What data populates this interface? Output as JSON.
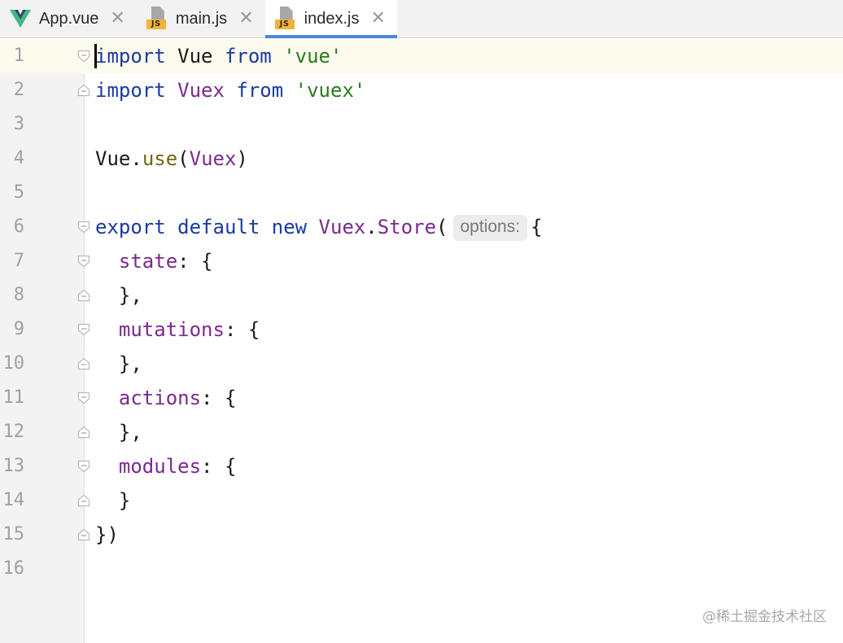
{
  "tabs": [
    {
      "label": "App.vue",
      "icon": "vue-icon",
      "active": false
    },
    {
      "label": "main.js",
      "icon": "js-file-icon",
      "active": false
    },
    {
      "label": "index.js",
      "icon": "js-file-icon",
      "active": true
    }
  ],
  "js_badge": "JS",
  "close_glyph": "✕",
  "hint": "options:",
  "line_numbers": [
    "1",
    "2",
    "3",
    "4",
    "5",
    "6",
    "7",
    "8",
    "9",
    "10",
    "11",
    "12",
    "13",
    "14",
    "15",
    "16"
  ],
  "code": {
    "l1": {
      "kw1": "import",
      "name": " Vue ",
      "kw2": "from",
      "str": " 'vue'"
    },
    "l2": {
      "kw1": "import",
      "name": " Vuex ",
      "kw2": "from",
      "str": " 'vuex'"
    },
    "l4": {
      "obj": "Vue",
      "dot": ".",
      "fn": "use",
      "open": "(",
      "arg": "Vuex",
      "close": ")"
    },
    "l6": {
      "kw1": "export",
      "kw2": " default",
      "kw3": " new",
      "cls": " Vuex",
      "dot": ".",
      "ctor": "Store",
      "open": "(",
      "brace": "{"
    },
    "l7": {
      "prop": "  state",
      "rest": ": {"
    },
    "l8": {
      "text": "  },"
    },
    "l9": {
      "prop": "  mutations",
      "rest": ": {"
    },
    "l10": {
      "text": "  },"
    },
    "l11": {
      "prop": "  actions",
      "rest": ": {"
    },
    "l12": {
      "text": "  },"
    },
    "l13": {
      "prop": "  modules",
      "rest": ": {"
    },
    "l14": {
      "text": "  }"
    },
    "l15": {
      "text": "})"
    }
  },
  "colors": {
    "keyword": "#1a3aa0",
    "string": "#2a7a1e",
    "class": "#7a2a8e",
    "function": "#6a6a10",
    "active_tab_underline": "#4a88d6"
  },
  "watermark": "@稀土掘金技术社区"
}
